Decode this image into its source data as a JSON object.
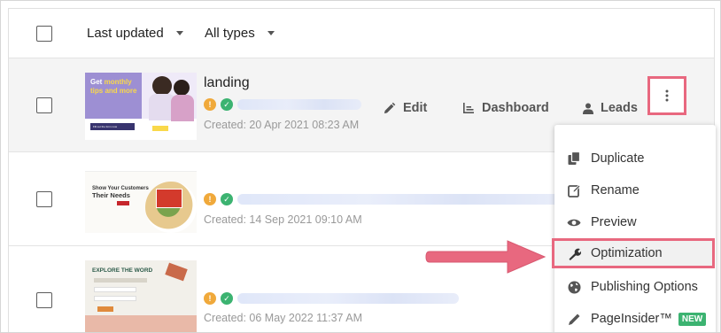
{
  "toolbar": {
    "sort_label": "Last updated",
    "type_label": "All types"
  },
  "rows": [
    {
      "title": "landing",
      "created": "Created: 20 Apr 2021 08:23 AM",
      "status_warn": "!",
      "status_ok": "✓",
      "thumb": {
        "headline_1": "Get",
        "headline_2": "monthly",
        "headline_3": "tips and more",
        "button": "Fill out the form now"
      }
    },
    {
      "title": "",
      "created": "Created: 14 Sep 2021 09:10 AM",
      "status_warn": "!",
      "status_ok": "✓",
      "thumb": {
        "headline_1": "Show Your Customers",
        "headline_2": "Their Needs"
      }
    },
    {
      "title": "",
      "created": "Created: 06 May 2022 11:37 AM",
      "status_warn": "!",
      "status_ok": "✓",
      "thumb": {
        "headline_1": "EXPLORE THE WORD"
      }
    }
  ],
  "actions": {
    "edit": "Edit",
    "dashboard": "Dashboard",
    "leads": "Leads"
  },
  "menu": {
    "items": [
      {
        "label": "Duplicate",
        "icon": "duplicate-icon"
      },
      {
        "label": "Rename",
        "icon": "rename-icon"
      },
      {
        "label": "Preview",
        "icon": "eye-icon"
      },
      {
        "label": "Optimization",
        "icon": "wrench-icon"
      },
      {
        "label": "Publishing Options",
        "icon": "globe-icon"
      },
      {
        "label": "PageInsider™",
        "icon": "pen-icon",
        "badge": "NEW"
      }
    ]
  },
  "colors": {
    "highlight": "#e8687f",
    "success": "#3cb371",
    "warning": "#f0a93b"
  }
}
